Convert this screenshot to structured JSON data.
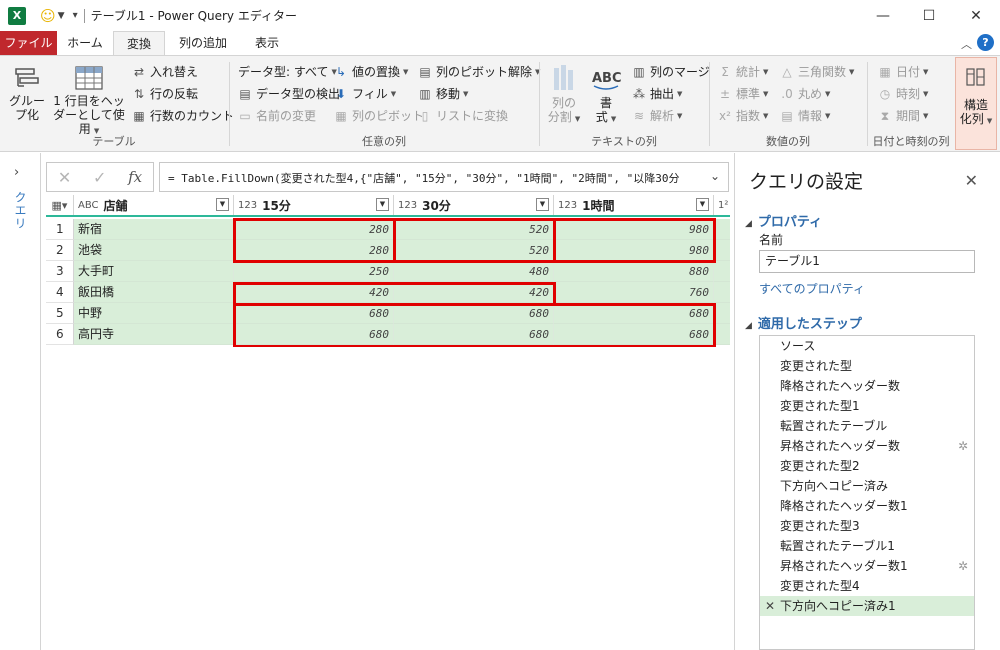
{
  "window": {
    "app_logo": "X",
    "title": "テーブル1 - Power Query エディター",
    "icons": {
      "smiley": "smiley-icon",
      "minimize": "minimize-icon",
      "maximize": "maximize-icon",
      "close": "close-icon"
    }
  },
  "tabs": [
    "ファイル",
    "ホーム",
    "変換",
    "列の追加",
    "表示"
  ],
  "active_tab": "変換",
  "ribbon": {
    "table": {
      "group_label": "テーブル",
      "group_by": "グループ化",
      "group_by_lines": [
        "グルー",
        "プ化"
      ],
      "use_first_row_lines": [
        "1 行目をヘッ",
        "ダーとして使用"
      ],
      "transpose": "入れ替え",
      "reverse_rows": "行の反転",
      "count_rows": "行数のカウント"
    },
    "any_column": {
      "group_label": "任意の列",
      "data_type": "データ型: すべて",
      "detect_type": "データ型の検出",
      "rename": "名前の変更",
      "replace_values": "値の置換",
      "fill": "フィル",
      "pivot_column": "列のピボット",
      "unpivot": "列のピボット解除",
      "move": "移動",
      "to_list": "リストに変換"
    },
    "text_column": {
      "group_label": "テキストの列",
      "split_lines": [
        "列の",
        "分割"
      ],
      "format_lines": [
        "書",
        "式"
      ],
      "merge_columns": "列のマージ",
      "extract": "抽出",
      "parse": "解析"
    },
    "number_column": {
      "group_label": "数値の列",
      "statistics": "統計",
      "standard": "標準",
      "scientific": "指数",
      "trigonometry": "三角関数",
      "rounding": "丸め",
      "information": "情報"
    },
    "datetime_column": {
      "group_label": "日付と時刻の列",
      "date": "日付",
      "time": "時刻",
      "duration": "期間"
    },
    "structured": {
      "lines": [
        "構造",
        "化列"
      ]
    }
  },
  "left_pane": {
    "label": "クエリ"
  },
  "formula_bar": {
    "formula": "= Table.FillDown(変更された型4,{\"店舗\", \"15分\", \"30分\", \"1時間\", \"2時間\", \"以降30分"
  },
  "grid": {
    "columns": [
      {
        "type": "ABC",
        "name": "店舗"
      },
      {
        "type": "123",
        "name": "15分"
      },
      {
        "type": "123",
        "name": "30分"
      },
      {
        "type": "123",
        "name": "1時間"
      }
    ],
    "rows": [
      {
        "n": "1",
        "store": "新宿",
        "m15": "280",
        "m30": "520",
        "h1": "980"
      },
      {
        "n": "2",
        "store": "池袋",
        "m15": "280",
        "m30": "520",
        "h1": "980"
      },
      {
        "n": "3",
        "store": "大手町",
        "m15": "250",
        "m30": "480",
        "h1": "880"
      },
      {
        "n": "4",
        "store": "飯田橋",
        "m15": "420",
        "m30": "420",
        "h1": "760"
      },
      {
        "n": "5",
        "store": "中野",
        "m15": "680",
        "m30": "680",
        "h1": "680"
      },
      {
        "n": "6",
        "store": "高円寺",
        "m15": "680",
        "m30": "680",
        "h1": "680"
      }
    ]
  },
  "query_settings": {
    "title": "クエリの設定",
    "properties_heading": "プロパティ",
    "name_label": "名前",
    "name_value": "テーブル1",
    "all_properties": "すべてのプロパティ",
    "applied_steps_heading": "適用したステップ",
    "steps": [
      {
        "label": "ソース",
        "gear": false
      },
      {
        "label": "変更された型",
        "gear": false
      },
      {
        "label": "降格されたヘッダー数",
        "gear": false
      },
      {
        "label": "変更された型1",
        "gear": false
      },
      {
        "label": "転置されたテーブル",
        "gear": false
      },
      {
        "label": "昇格されたヘッダー数",
        "gear": true
      },
      {
        "label": "変更された型2",
        "gear": false
      },
      {
        "label": "下方向へコピー済み",
        "gear": false
      },
      {
        "label": "降格されたヘッダー数1",
        "gear": false
      },
      {
        "label": "変更された型3",
        "gear": false
      },
      {
        "label": "転置されたテーブル1",
        "gear": false
      },
      {
        "label": "昇格されたヘッダー数1",
        "gear": true
      },
      {
        "label": "変更された型4",
        "gear": false
      },
      {
        "label": "下方向へコピー済み1",
        "gear": false,
        "active": true
      }
    ]
  },
  "colors": {
    "file_tab": "#c0282d",
    "excel_green": "#107c41",
    "selection_green": "#d9eed9",
    "header_accent": "#2db899",
    "highlight_red": "#e00000",
    "link_blue": "#2f6aa9"
  }
}
